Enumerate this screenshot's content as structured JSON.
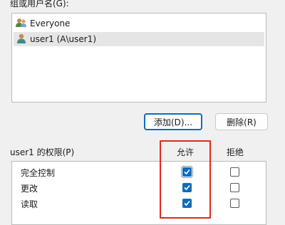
{
  "group_label": "组或用户名(G):",
  "users": [
    {
      "name": "Everyone",
      "icon": "group-icon",
      "selected": false
    },
    {
      "name": "user1 (A\\user1)",
      "icon": "user-icon",
      "selected": true
    }
  ],
  "buttons": {
    "add": "添加(D)...",
    "remove": "删除(R)"
  },
  "permissions": {
    "label": "user1 的权限(P)",
    "allow_header": "允许",
    "deny_header": "拒绝",
    "rows": [
      {
        "name": "完全控制",
        "allow": true,
        "deny": false
      },
      {
        "name": "更改",
        "allow": true,
        "deny": false
      },
      {
        "name": "读取",
        "allow": true,
        "deny": false
      }
    ]
  },
  "colors": {
    "accent": "#0f6cbd",
    "highlight_frame": "#e8261a"
  }
}
